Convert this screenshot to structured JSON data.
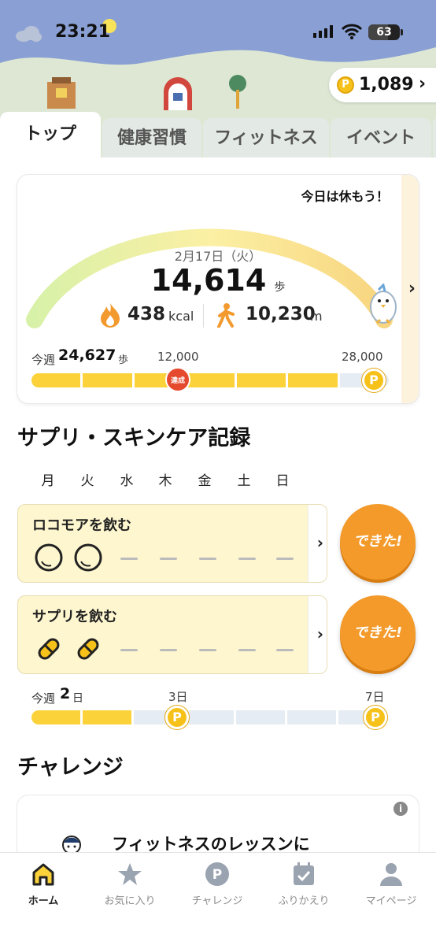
{
  "status": {
    "time": "23:21",
    "battery": "63",
    "battery_level": 0.63
  },
  "points": {
    "coin_symbol": "P",
    "value": "1,089",
    "chevron": "›"
  },
  "tabs": [
    {
      "label": "トップ",
      "active": true
    },
    {
      "label": "健康習慣",
      "active": false
    },
    {
      "label": "フィットネス",
      "active": false
    },
    {
      "label": "イベント",
      "active": false
    }
  ],
  "steps_card": {
    "message": "今日は休もう！",
    "date": "2月17日（火）",
    "steps": "14,614",
    "steps_unit": "歩",
    "kcal": "438",
    "kcal_unit": "kcal",
    "distance": "10,230",
    "distance_unit": "m",
    "chevron": "›",
    "weekly": {
      "label": "今週",
      "steps": "24,627",
      "unit": "歩",
      "milestone_1": "12,000",
      "milestone_2": "28,000",
      "badge": "達成",
      "filled_segments": 6,
      "total_segments": 7
    }
  },
  "supplements": {
    "title": "サプリ・スキンケア記録",
    "weekdays": [
      "月",
      "火",
      "水",
      "木",
      "金",
      "土",
      "日"
    ],
    "active_day_index": 1,
    "tasks": [
      {
        "title": "ロコモアを飲む",
        "icon": "capsule-ring-icon",
        "done_count": 2,
        "button": "できた!"
      },
      {
        "title": "サプリを飲む",
        "icon": "pill-icon",
        "done_count": 2,
        "button": "できた!"
      }
    ],
    "weekly": {
      "label": "今週",
      "count": "2",
      "unit": "日",
      "milestone_1": "3日",
      "milestone_2": "7日",
      "filled_segments": 2,
      "total_segments": 7
    }
  },
  "challenge": {
    "title": "チャレンジ",
    "info": "i",
    "text": "フィットネスのレッスンに"
  },
  "nav": [
    {
      "label": "ホーム",
      "icon": "home-icon",
      "active": true
    },
    {
      "label": "お気に入り",
      "icon": "star-icon",
      "active": false
    },
    {
      "label": "チャレンジ",
      "icon": "point-coin-icon",
      "active": false
    },
    {
      "label": "ふりかえり",
      "icon": "calendar-check-icon",
      "active": false
    },
    {
      "label": "マイページ",
      "icon": "person-icon",
      "active": false
    }
  ],
  "colors": {
    "accent": "#fbd23a",
    "button": "#f39a2a",
    "header_sky": "#8a9fd3",
    "hill": "#dde7d4"
  }
}
